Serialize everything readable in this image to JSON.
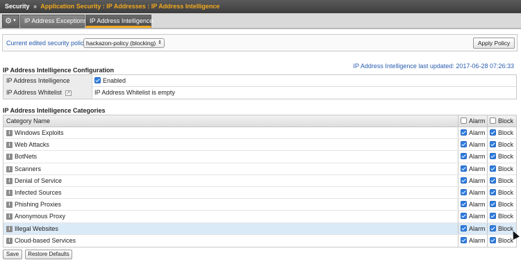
{
  "breadcrumb": {
    "root": "Security",
    "separator": "»",
    "path": "Application Security : IP Addresses : IP Address Intelligence"
  },
  "tabs": [
    {
      "label": "IP Address Exceptions",
      "active": false
    },
    {
      "label": "IP Address Intelligence",
      "active": true
    }
  ],
  "policy": {
    "label": "Current edited security policy",
    "selected": "hackazon-policy (blocking)",
    "apply_label": "Apply Policy"
  },
  "last_updated": "IP Address Intelligence last updated: 2017-06-28 07:26:33",
  "config": {
    "heading": "IP Address Intelligence Configuration",
    "rows": [
      {
        "label": "IP Address Intelligence",
        "value": "Enabled",
        "checked": true
      },
      {
        "label": "IP Address Whitelist",
        "value": "IP Address Whitelist is empty"
      }
    ]
  },
  "categories": {
    "heading": "IP Address Intelligence Categories",
    "columns": {
      "name": "Category Name",
      "alarm": "Alarm",
      "block": "Block"
    },
    "rows": [
      {
        "name": "Windows Exploits",
        "alarm": "Alarm",
        "block": "Block"
      },
      {
        "name": "Web Attacks",
        "alarm": "Alarm",
        "block": "Block"
      },
      {
        "name": "BotNets",
        "alarm": "Alarm",
        "block": "Block"
      },
      {
        "name": "Scanners",
        "alarm": "Alarm",
        "block": "Block"
      },
      {
        "name": "Denial of Service",
        "alarm": "Alarm",
        "block": "Block"
      },
      {
        "name": "Infected Sources",
        "alarm": "Alarm",
        "block": "Block"
      },
      {
        "name": "Phishing Proxies",
        "alarm": "Alarm",
        "block": "Block"
      },
      {
        "name": "Anonymous Proxy",
        "alarm": "Alarm",
        "block": "Block"
      },
      {
        "name": "Illegal Websites",
        "alarm": "Alarm",
        "block": "Block"
      },
      {
        "name": "Cloud-based Services",
        "alarm": "Alarm",
        "block": "Block"
      }
    ]
  },
  "buttons": {
    "save": "Save",
    "restore": "Restore Defaults"
  },
  "colors": {
    "accent": "#f2a91e",
    "link": "#2a5db0",
    "checkbox": "#2e7de1",
    "selected_row": "#dbeaf7"
  },
  "icons": {
    "gear": "gear-icon",
    "info": "info-icon",
    "external": "external-link-icon"
  }
}
